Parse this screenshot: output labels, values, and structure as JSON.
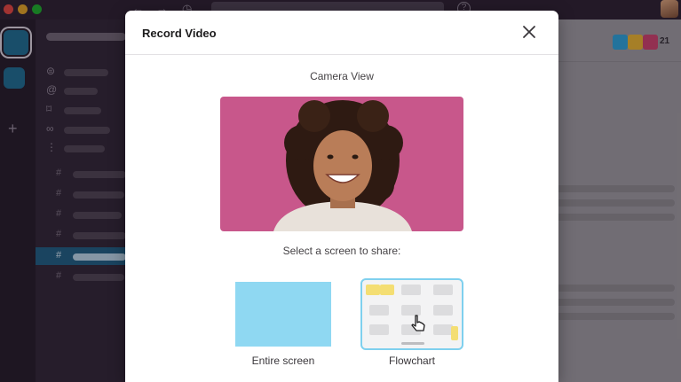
{
  "modal": {
    "title": "Record Video",
    "close_icon": "close-icon",
    "camera_label": "Camera View",
    "share_prompt": "Select a screen to share:",
    "share_options": [
      {
        "label": "Entire screen",
        "selected": false
      },
      {
        "label": "Flowchart",
        "selected": true
      }
    ]
  },
  "header": {
    "member_count": "21"
  },
  "colors": {
    "camera_background": "#c8578b",
    "selection_accent": "#7fd0ee",
    "entire_screen_thumb": "#8fd8f2",
    "sidebar_selected": "#1d5c80"
  },
  "icons": {
    "back": "arrow-left-icon",
    "forward": "arrow-right-icon",
    "history": "clock-icon",
    "help": "help-icon",
    "add_workspace": "plus-icon",
    "threads": "threads-icon",
    "mentions": "at-icon",
    "saved": "bookmark-icon",
    "connect": "link-icon",
    "more": "more-icon",
    "channel": "hash-icon",
    "cursor": "hand-cursor-icon"
  }
}
